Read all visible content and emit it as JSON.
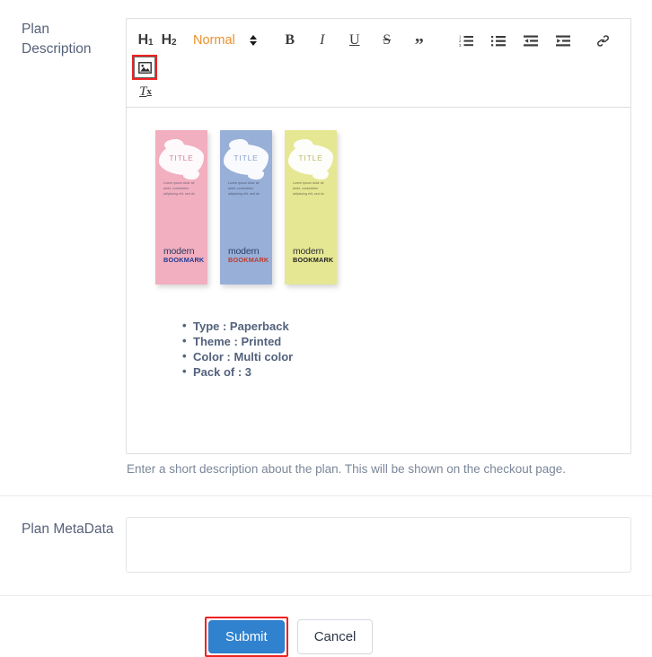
{
  "form": {
    "description_field": {
      "label_lines": [
        "Plan",
        "Description"
      ],
      "help_text": "Enter a short description about the plan. This will be shown on the checkout page."
    },
    "metadata_field": {
      "label": "Plan MetaData",
      "value": "",
      "placeholder": ""
    }
  },
  "toolbar": {
    "h1_label": "H",
    "h1_sub": "1",
    "h2_label": "H",
    "h2_sub": "2",
    "clear_format_label": "T",
    "clear_format_sub": "x",
    "style_select": {
      "value": "Normal",
      "value_color": "#e8912d"
    },
    "bold_label": "B",
    "italic_label": "I",
    "underline_label": "U",
    "strike_label": "S",
    "quote_label": "”",
    "highlight_color": "#ee2222"
  },
  "editor_content": {
    "bookmarks": [
      {
        "color": "#f2afc0",
        "title": "TITLE",
        "lorem": "Lorem ipsum dolor sit amet, consectetur adipiscing elit, sed do",
        "brand_top": "modern",
        "brand_bottom": "BOOKMARK"
      },
      {
        "color": "#98b0d8",
        "title": "TITLE",
        "lorem": "Lorem ipsum dolor sit amet, consectetur adipiscing elit, sed do",
        "brand_top": "modern",
        "brand_bottom": "BOOKMARK"
      },
      {
        "color": "#e5e793",
        "title": "TITLE",
        "lorem": "Lorem ipsum dolor sit amet, consectetur adipiscing elit, sed do",
        "brand_top": "modern",
        "brand_bottom": "BOOKMARK"
      }
    ],
    "spec_list": [
      "Type : Paperback",
      "Theme : Printed",
      "Color : Multi color",
      "Pack of : 3"
    ]
  },
  "actions": {
    "submit_label": "Submit",
    "cancel_label": "Cancel",
    "submit_color": "#3182ce"
  }
}
